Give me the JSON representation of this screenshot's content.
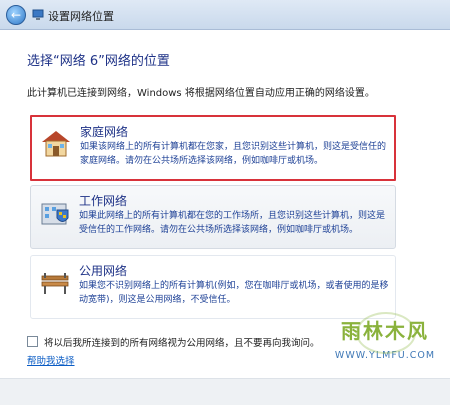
{
  "window": {
    "title": "设置网络位置",
    "back_icon": "back-arrow-icon",
    "title_icon": "network-icon"
  },
  "heading": "选择“网络  6”网络的位置",
  "description": "此计算机已连接到网络，Windows 将根据网络位置自动应用正确的网络设置。",
  "options": [
    {
      "title": "家庭网络",
      "description": "如果该网络上的所有计算机都在您家，且您识别这些计算机，则这是受信任的家庭网络。请勿在公共场所选择该网络，例如咖啡厅或机场。",
      "icon": "home-network-icon",
      "selected": true
    },
    {
      "title": "工作网络",
      "description": "如果此网络上的所有计算机都在您的工作场所，且您识别这些计算机，则这是受信任的工作网络。请勿在公共场所选择该网络，例如咖啡厅或机场。",
      "icon": "work-network-icon",
      "selected": false
    },
    {
      "title": "公用网络",
      "description": "如果您不识别网络上的所有计算机(例如，您在咖啡厅或机场，或者使用的是移动宽带)，则这是公用网络，不受信任。",
      "icon": "public-network-icon",
      "selected": false
    }
  ],
  "checkbox": {
    "label": "将以后我所连接到的所有网络视为公用网络，且不要再向我询问。",
    "checked": false
  },
  "help_link": "帮助我选择",
  "watermark": {
    "main": "雨林木风",
    "url": "WWW.YLMFU.COM"
  },
  "colors": {
    "selection_border": "#d8323a",
    "heading": "#1e3287",
    "link": "#0b5cc4"
  }
}
